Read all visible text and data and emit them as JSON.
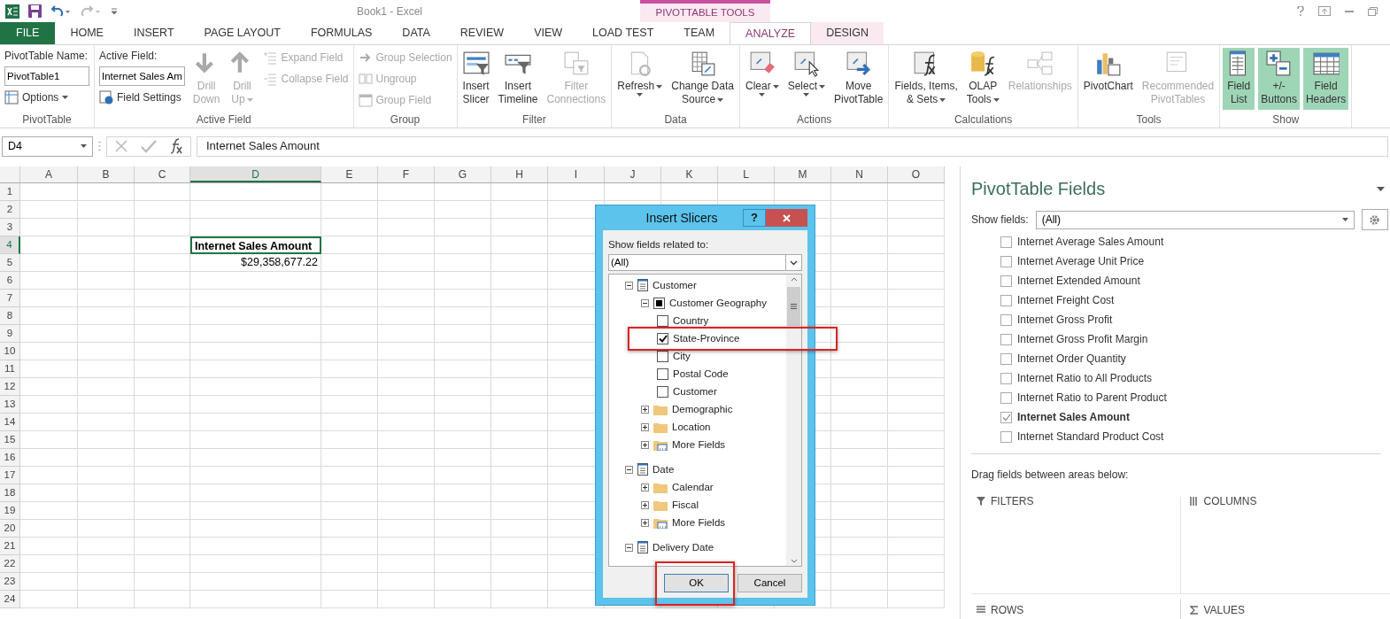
{
  "title_bar": {
    "document_title": "Book1 - Excel"
  },
  "contextual_label": "PIVOTTABLE TOOLS",
  "ribbon_tabs": [
    {
      "label": "FILE",
      "kind": "file",
      "selected": false
    },
    {
      "label": "HOME",
      "kind": "plain",
      "selected": false
    },
    {
      "label": "INSERT",
      "kind": "plain",
      "selected": false
    },
    {
      "label": "PAGE LAYOUT",
      "kind": "plain",
      "selected": false
    },
    {
      "label": "FORMULAS",
      "kind": "plain",
      "selected": false
    },
    {
      "label": "DATA",
      "kind": "plain",
      "selected": false
    },
    {
      "label": "REVIEW",
      "kind": "plain",
      "selected": false
    },
    {
      "label": "VIEW",
      "kind": "plain",
      "selected": false
    },
    {
      "label": "LOAD TEST",
      "kind": "plain",
      "selected": false
    },
    {
      "label": "TEAM",
      "kind": "plain",
      "selected": false
    },
    {
      "label": "ANALYZE",
      "kind": "contextual",
      "selected": true
    },
    {
      "label": "DESIGN",
      "kind": "contextual",
      "selected": false
    }
  ],
  "ribbon_groups": [
    {
      "label": "PivotTable",
      "columns": [
        [
          {
            "kind": "field",
            "label": "PivotTable Name:",
            "value": "PivotTable1"
          },
          {
            "kind": "small",
            "label": "Options",
            "dropdown": true,
            "disabled": false
          }
        ]
      ]
    },
    {
      "label": "Active Field",
      "columns": [
        [
          {
            "kind": "field",
            "label": "Active Field:",
            "value": "Internet Sales Am"
          },
          {
            "kind": "small",
            "label": "Field Settings",
            "dropdown": false,
            "disabled": false
          }
        ],
        [
          {
            "kind": "large",
            "lines": [
              "Drill",
              "Down"
            ],
            "dropdown": false,
            "disabled": true,
            "selected": false
          }
        ],
        [
          {
            "kind": "large",
            "lines": [
              "Drill",
              "Up"
            ],
            "dropdown": true,
            "disabled": true,
            "selected": false
          }
        ],
        [
          {
            "kind": "small",
            "label": "Expand Field",
            "dropdown": false,
            "disabled": true
          },
          {
            "kind": "small",
            "label": "Collapse Field",
            "dropdown": false,
            "disabled": true
          }
        ]
      ]
    },
    {
      "label": "Group",
      "columns": [
        [
          {
            "kind": "small",
            "label": "Group Selection",
            "dropdown": false,
            "disabled": true
          },
          {
            "kind": "small",
            "label": "Ungroup",
            "dropdown": false,
            "disabled": true
          },
          {
            "kind": "small",
            "label": "Group Field",
            "dropdown": false,
            "disabled": true
          }
        ]
      ]
    },
    {
      "label": "Filter",
      "columns": [
        [
          {
            "kind": "large",
            "lines": [
              "Insert",
              "Slicer"
            ],
            "dropdown": false,
            "disabled": false,
            "selected": false
          }
        ],
        [
          {
            "kind": "large",
            "lines": [
              "Insert",
              "Timeline"
            ],
            "dropdown": false,
            "disabled": false,
            "selected": false
          }
        ],
        [
          {
            "kind": "large",
            "lines": [
              "Filter",
              "Connections"
            ],
            "dropdown": false,
            "disabled": true,
            "selected": false
          }
        ]
      ]
    },
    {
      "label": "Data",
      "columns": [
        [
          {
            "kind": "large",
            "lines": [
              "Refresh"
            ],
            "dropdown": true,
            "disabled": false,
            "selected": false
          }
        ],
        [
          {
            "kind": "large",
            "lines": [
              "Change Data",
              "Source"
            ],
            "dropdown": true,
            "disabled": false,
            "selected": false
          }
        ]
      ]
    },
    {
      "label": "Actions",
      "columns": [
        [
          {
            "kind": "large",
            "lines": [
              "Clear"
            ],
            "dropdown": true,
            "disabled": false,
            "selected": false
          }
        ],
        [
          {
            "kind": "large",
            "lines": [
              "Select"
            ],
            "dropdown": true,
            "disabled": false,
            "selected": false
          }
        ],
        [
          {
            "kind": "large",
            "lines": [
              "Move",
              "PivotTable"
            ],
            "dropdown": false,
            "disabled": false,
            "selected": false
          }
        ]
      ]
    },
    {
      "label": "Calculations",
      "columns": [
        [
          {
            "kind": "large",
            "lines": [
              "Fields, Items,",
              "& Sets"
            ],
            "dropdown": true,
            "disabled": false,
            "selected": false
          }
        ],
        [
          {
            "kind": "large",
            "lines": [
              "OLAP",
              "Tools"
            ],
            "dropdown": true,
            "disabled": false,
            "selected": false
          }
        ],
        [
          {
            "kind": "large",
            "lines": [
              "Relationships"
            ],
            "dropdown": false,
            "disabled": true,
            "selected": false
          }
        ]
      ]
    },
    {
      "label": "Tools",
      "columns": [
        [
          {
            "kind": "large",
            "lines": [
              "PivotChart"
            ],
            "dropdown": false,
            "disabled": false,
            "selected": false
          }
        ],
        [
          {
            "kind": "large",
            "lines": [
              "Recommended",
              "PivotTables"
            ],
            "dropdown": false,
            "disabled": true,
            "selected": false
          }
        ]
      ]
    },
    {
      "label": "Show",
      "columns": [
        [
          {
            "kind": "large",
            "lines": [
              "Field",
              "List"
            ],
            "dropdown": false,
            "disabled": false,
            "selected": true
          }
        ],
        [
          {
            "kind": "large",
            "lines": [
              "+/-",
              "Buttons"
            ],
            "dropdown": false,
            "disabled": false,
            "selected": true
          }
        ],
        [
          {
            "kind": "large",
            "lines": [
              "Field",
              "Headers"
            ],
            "dropdown": false,
            "disabled": false,
            "selected": true
          }
        ]
      ]
    }
  ],
  "formula_bar": {
    "name_box": "D4",
    "formula": "Internet Sales Amount"
  },
  "sheet": {
    "columns": [
      {
        "label": "A",
        "selected": false
      },
      {
        "label": "B",
        "selected": false
      },
      {
        "label": "C",
        "selected": false
      },
      {
        "label": "D",
        "selected": true
      },
      {
        "label": "E",
        "selected": false
      },
      {
        "label": "F",
        "selected": false
      },
      {
        "label": "G",
        "selected": false
      },
      {
        "label": "H",
        "selected": false
      },
      {
        "label": "I",
        "selected": false
      },
      {
        "label": "J",
        "selected": false
      },
      {
        "label": "K",
        "selected": false
      },
      {
        "label": "L",
        "selected": false
      },
      {
        "label": "M",
        "selected": false
      },
      {
        "label": "N",
        "selected": false
      },
      {
        "label": "O",
        "selected": false
      }
    ],
    "rows": [
      {
        "label": "1",
        "selected": false
      },
      {
        "label": "2",
        "selected": false
      },
      {
        "label": "3",
        "selected": false
      },
      {
        "label": "4",
        "selected": true,
        "cells": {
          "D": {
            "text": "Internet Sales Amount",
            "kind": "header",
            "selected": true
          }
        }
      },
      {
        "label": "5",
        "selected": false,
        "cells": {
          "D": {
            "text": "$29,358,677.22",
            "kind": "value",
            "selected": false
          }
        }
      },
      {
        "label": "6",
        "selected": false
      },
      {
        "label": "7",
        "selected": false
      },
      {
        "label": "8",
        "selected": false
      },
      {
        "label": "9",
        "selected": false
      },
      {
        "label": "10",
        "selected": false
      },
      {
        "label": "11",
        "selected": false
      },
      {
        "label": "12",
        "selected": false
      },
      {
        "label": "13",
        "selected": false
      },
      {
        "label": "14",
        "selected": false
      },
      {
        "label": "15",
        "selected": false
      },
      {
        "label": "16",
        "selected": false
      },
      {
        "label": "17",
        "selected": false
      },
      {
        "label": "18",
        "selected": false
      },
      {
        "label": "19",
        "selected": false
      },
      {
        "label": "20",
        "selected": false
      },
      {
        "label": "21",
        "selected": false
      },
      {
        "label": "22",
        "selected": false
      },
      {
        "label": "23",
        "selected": false
      },
      {
        "label": "24",
        "selected": false
      }
    ]
  },
  "dialog": {
    "title": "Insert Slicers",
    "help": "?",
    "related_label": "Show fields related to:",
    "related_value": "(All)",
    "tree": [
      {
        "label": "Customer",
        "kind": "table",
        "expanded": true,
        "children": [
          {
            "label": "Customer Geography",
            "kind": "hierarchy",
            "expanded": true,
            "partial": true,
            "children": [
              {
                "label": "Country",
                "kind": "field",
                "checked": false
              },
              {
                "label": "State-Province",
                "kind": "field",
                "checked": true
              },
              {
                "label": "City",
                "kind": "field",
                "checked": false
              },
              {
                "label": "Postal Code",
                "kind": "field",
                "checked": false
              },
              {
                "label": "Customer",
                "kind": "field",
                "checked": false
              }
            ]
          },
          {
            "label": "Demographic",
            "kind": "folder",
            "expanded": false
          },
          {
            "label": "Location",
            "kind": "folder",
            "expanded": false
          },
          {
            "label": "More Fields",
            "kind": "more",
            "expanded": false
          }
        ]
      },
      {
        "label": "Date",
        "kind": "table",
        "expanded": true,
        "children": [
          {
            "label": "Calendar",
            "kind": "folder",
            "expanded": false
          },
          {
            "label": "Fiscal",
            "kind": "folder",
            "expanded": false
          },
          {
            "label": "More Fields",
            "kind": "more",
            "expanded": false
          }
        ]
      },
      {
        "label": "Delivery Date",
        "kind": "table",
        "expanded": true
      }
    ],
    "buttons": [
      {
        "label": "OK",
        "selected": true
      },
      {
        "label": "Cancel",
        "selected": false
      }
    ]
  },
  "field_list": {
    "title": "PivotTable Fields",
    "show_label": "Show fields:",
    "show_value": "(All)",
    "fields": [
      {
        "label": "Internet Average Sales Amount",
        "checked": false
      },
      {
        "label": "Internet Average Unit Price",
        "checked": false
      },
      {
        "label": "Internet Extended Amount",
        "checked": false
      },
      {
        "label": "Internet Freight Cost",
        "checked": false
      },
      {
        "label": "Internet Gross Profit",
        "checked": false
      },
      {
        "label": "Internet Gross Profit Margin",
        "checked": false
      },
      {
        "label": "Internet Order Quantity",
        "checked": false
      },
      {
        "label": "Internet Ratio to All Products",
        "checked": false
      },
      {
        "label": "Internet Ratio to Parent Product",
        "checked": false
      },
      {
        "label": "Internet Sales Amount",
        "checked": true
      },
      {
        "label": "Internet Standard Product Cost",
        "checked": false
      }
    ],
    "drag_hint": "Drag fields between areas below:",
    "areas": [
      {
        "label": "FILTERS"
      },
      {
        "label": "COLUMNS"
      },
      {
        "label": "ROWS"
      },
      {
        "label": "VALUES"
      }
    ]
  }
}
